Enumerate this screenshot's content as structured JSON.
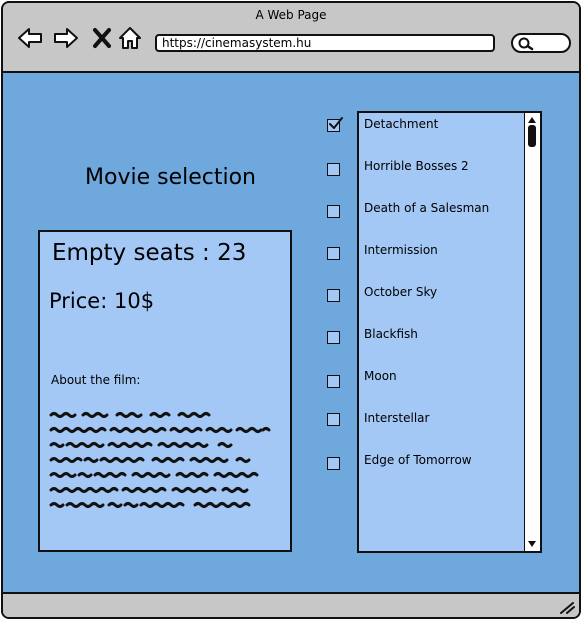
{
  "window": {
    "title": "A Web Page"
  },
  "browser": {
    "url": "https://cinemasystem.hu",
    "nav_icons": [
      "back-arrow-icon",
      "forward-arrow-icon",
      "close-x-icon",
      "home-icon"
    ],
    "search_icon": "magnifier-icon"
  },
  "page": {
    "heading": "Movie selection",
    "seats_text": "Empty seats : 23",
    "price_text": "Price: 10$",
    "about_label": "About the film:"
  },
  "movies": [
    {
      "title": "Detachment",
      "checked": true
    },
    {
      "title": "Horrible Bosses 2",
      "checked": false
    },
    {
      "title": "Death of a Salesman",
      "checked": false
    },
    {
      "title": "Intermission",
      "checked": false
    },
    {
      "title": "October Sky",
      "checked": false
    },
    {
      "title": "Blackfish",
      "checked": false
    },
    {
      "title": "Moon",
      "checked": false
    },
    {
      "title": "Interstellar",
      "checked": false
    },
    {
      "title": "Edge of Tomorrow",
      "checked": false
    }
  ],
  "colors": {
    "content_bg": "#6fa8dc",
    "panel_bg": "#a4c8f5",
    "chrome_bg": "#c7c7c7"
  }
}
